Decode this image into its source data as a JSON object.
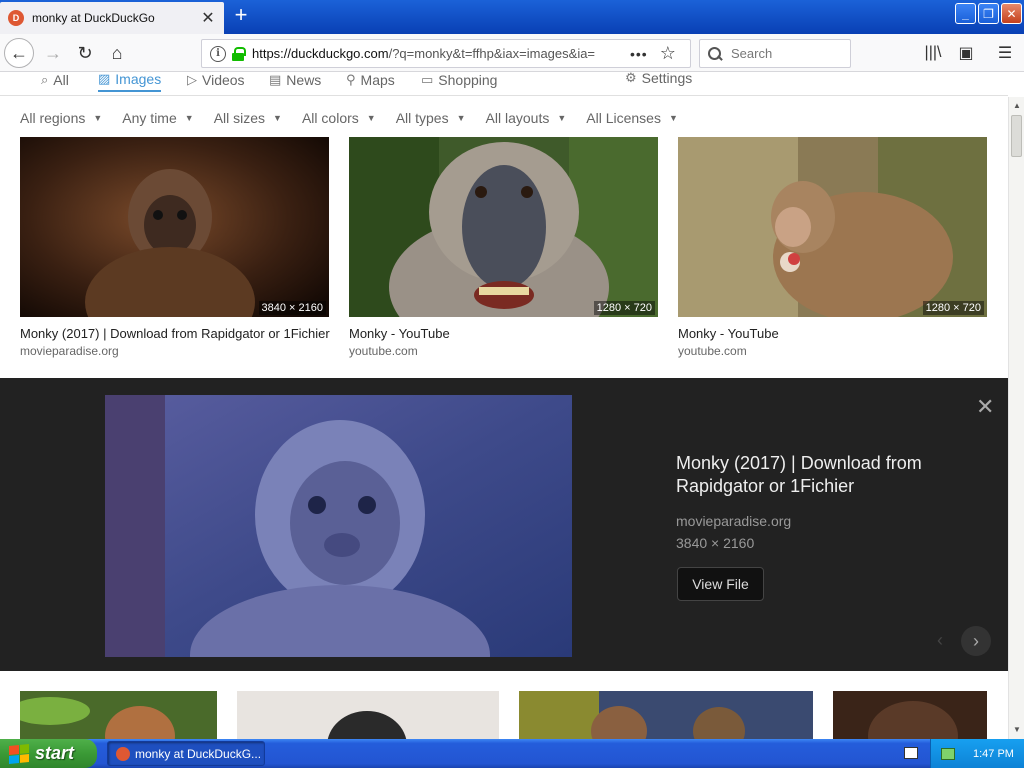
{
  "browser": {
    "tab_title": "monky at DuckDuckGo",
    "url_host": "https://duckduckgo.com",
    "url_rest": "/?q=monky&t=ffhp&iax=images&ia=",
    "search_placeholder": "Search"
  },
  "ddg_tabs": [
    {
      "label": "All",
      "icon": "search-icon"
    },
    {
      "label": "Images",
      "icon": "image-icon",
      "active": true
    },
    {
      "label": "Videos",
      "icon": "video-icon"
    },
    {
      "label": "News",
      "icon": "news-icon"
    },
    {
      "label": "Maps",
      "icon": "map-pin-icon"
    },
    {
      "label": "Shopping",
      "icon": "shopping-bag-icon"
    },
    {
      "label": "Settings",
      "icon": "sliders-icon"
    }
  ],
  "filters": [
    "All regions",
    "Any time",
    "All sizes",
    "All colors",
    "All types",
    "All layouts",
    "All Licenses"
  ],
  "results": [
    {
      "title": "Monky (2017) | Download from Rapidgator or 1Fichier",
      "source": "movieparadise.org",
      "dims": "3840 × 2160"
    },
    {
      "title": "Monky - YouTube",
      "source": "youtube.com",
      "dims": "1280 × 720"
    },
    {
      "title": "Monky - YouTube",
      "source": "youtube.com",
      "dims": "1280 × 720"
    }
  ],
  "detail": {
    "title": "Monky (2017) | Download from Rapidgator or 1Fichier",
    "source": "movieparadise.org",
    "dims": "3840 × 2160",
    "button": "View File"
  },
  "taskbar": {
    "start": "start",
    "item": "monky at DuckDuckG...",
    "clock": "1:47 PM"
  },
  "colors": {
    "accent": "#4495d4",
    "detail_bg": "#222222",
    "xp_blue": "#245ddb"
  }
}
